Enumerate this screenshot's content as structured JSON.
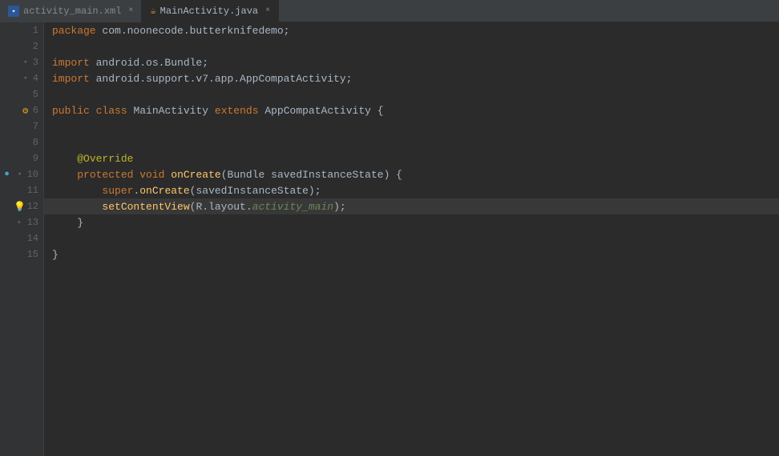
{
  "tabs": [
    {
      "id": "activity_main_xml",
      "label": "activity_main.xml",
      "icon": "xml",
      "active": false,
      "closeable": true
    },
    {
      "id": "mainactivity_java",
      "label": "MainActivity.java",
      "icon": "java",
      "active": true,
      "closeable": true
    }
  ],
  "editor": {
    "lines": [
      {
        "num": 1,
        "gutter_icons": [],
        "code": "package com.noonecode.butterknifedemo;"
      },
      {
        "num": 2,
        "gutter_icons": [],
        "code": ""
      },
      {
        "num": 3,
        "gutter_icons": [
          "fold"
        ],
        "code": "import android.os.Bundle;"
      },
      {
        "num": 4,
        "gutter_icons": [
          "fold"
        ],
        "code": "import android.support.v7.app.AppCompatActivity;"
      },
      {
        "num": 5,
        "gutter_icons": [],
        "code": ""
      },
      {
        "num": 6,
        "gutter_icons": [
          "android_icon"
        ],
        "code": "public class MainActivity extends AppCompatActivity {"
      },
      {
        "num": 7,
        "gutter_icons": [],
        "code": ""
      },
      {
        "num": 8,
        "gutter_icons": [],
        "code": ""
      },
      {
        "num": 9,
        "gutter_icons": [],
        "code": "    @Override"
      },
      {
        "num": 10,
        "gutter_icons": [
          "circle_blue",
          "fold"
        ],
        "code": "    protected void onCreate(Bundle savedInstanceState) {"
      },
      {
        "num": 11,
        "gutter_icons": [],
        "code": "        super.onCreate(savedInstanceState);"
      },
      {
        "num": 12,
        "gutter_icons": [
          "bulb"
        ],
        "code": "        setContentView(R.layout.activity_main);"
      },
      {
        "num": 13,
        "gutter_icons": [
          "fold"
        ],
        "code": "    }"
      },
      {
        "num": 14,
        "gutter_icons": [],
        "code": ""
      },
      {
        "num": 15,
        "gutter_icons": [],
        "code": "}"
      }
    ]
  }
}
